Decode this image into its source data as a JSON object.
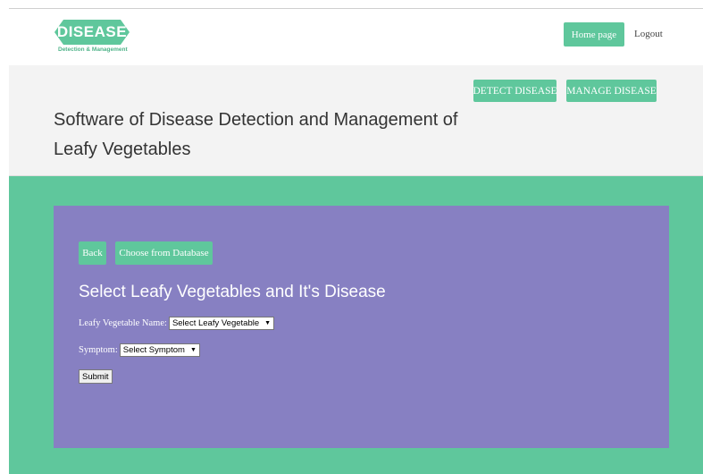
{
  "logo": {
    "title": "DISEASE",
    "subtitle": "Detection & Management"
  },
  "nav": {
    "home_label": "Home page",
    "logout_label": "Logout"
  },
  "hero": {
    "detect_label": "DETECT DISEASE",
    "manage_label": "MANAGE DISEASE",
    "title": "Software of Disease Detection and Management of Leafy Vegetables"
  },
  "panel": {
    "back_label": "Back",
    "choose_label": "Choose from Database",
    "title": "Select Leafy Vegetables and It's Disease",
    "vegetable_label": "Leafy Vegetable Name:",
    "vegetable_select": "Select Leafy Vegetable",
    "symptom_label": "Symptom:",
    "symptom_select": "Select Symptom",
    "submit_label": "Submit"
  },
  "colors": {
    "accent": "#5fc79c",
    "panel": "#8780c2",
    "hero_bg": "#f3f3f3"
  }
}
